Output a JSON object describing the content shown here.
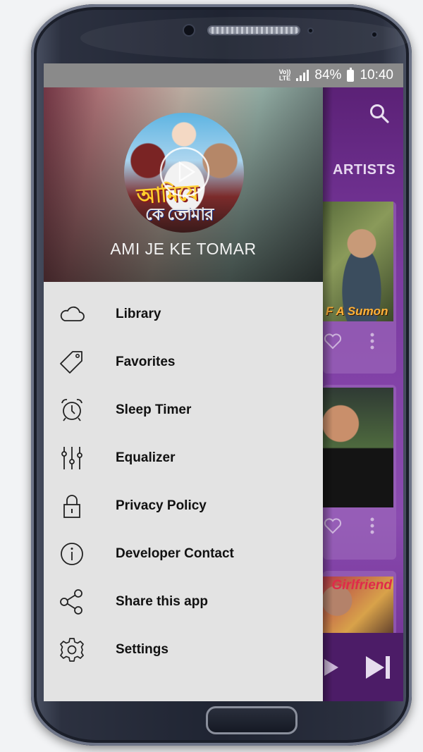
{
  "status_bar": {
    "network_line1": "Vo))",
    "network_line2": "LTE",
    "battery": "84%",
    "time": "10:40"
  },
  "app": {
    "tab_label": "ARTISTS",
    "cards": [
      {
        "caption": "F A Sumon"
      },
      {
        "caption": ""
      },
      {
        "caption": "Girlfriend"
      }
    ]
  },
  "drawer": {
    "now_playing_title": "AMI JE KE TOMAR",
    "album_art_text_line1": "আমিযে",
    "album_art_text_line2": "কে তোমার",
    "menu": [
      {
        "label": "Library",
        "icon": "cloud-icon"
      },
      {
        "label": "Favorites",
        "icon": "tag-icon"
      },
      {
        "label": "Sleep Timer",
        "icon": "alarm-clock-icon"
      },
      {
        "label": "Equalizer",
        "icon": "equalizer-icon"
      },
      {
        "label": "Privacy Policy",
        "icon": "lock-icon"
      },
      {
        "label": "Developer Contact",
        "icon": "info-icon"
      },
      {
        "label": "Share this app",
        "icon": "share-icon"
      },
      {
        "label": "Settings",
        "icon": "gear-icon"
      }
    ]
  },
  "colors": {
    "app_purple": "#6a2a8a",
    "drawer_bg": "#e3e3e3",
    "status_bar": "#8a8a8a"
  }
}
